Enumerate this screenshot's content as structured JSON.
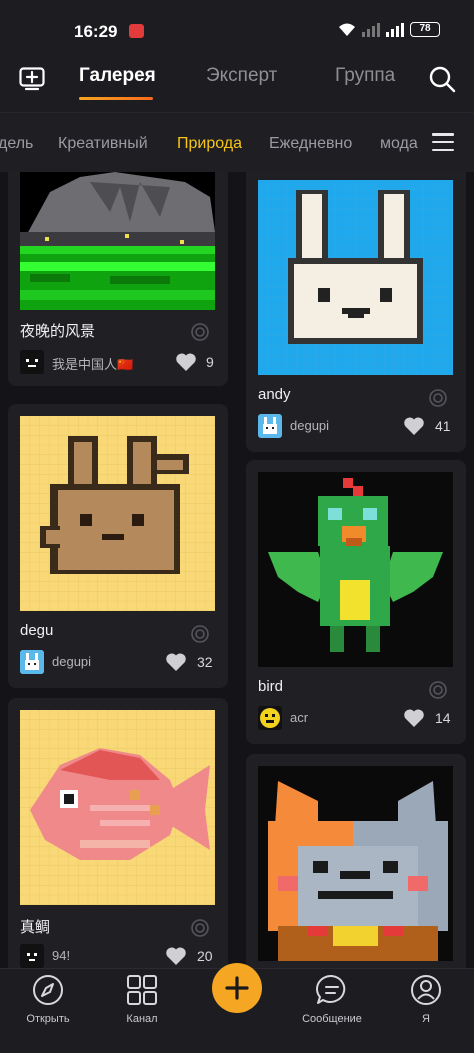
{
  "status_bar": {
    "time": "16:29",
    "battery": "78"
  },
  "header": {
    "tabs": [
      {
        "label": "Галерея",
        "active": true
      },
      {
        "label": "Эксперт",
        "active": false
      },
      {
        "label": "Группа",
        "active": false
      }
    ],
    "icons": {
      "left": "add-box-icon",
      "right": "search-icon"
    }
  },
  "categories": {
    "items": [
      "дель",
      "Креативный",
      "Природа",
      "Ежедневно",
      "мода"
    ],
    "active": "Природа",
    "menu_icon": "hamburger-menu-icon"
  },
  "feed": {
    "left": [
      {
        "title": "夜晚的风景",
        "user": "我是中国人🇨🇳",
        "likes": "9",
        "avatar_icon": "dark-face-avatar-icon"
      },
      {
        "title": "degu",
        "user": "degupi",
        "likes": "32",
        "avatar_icon": "bunny-avatar-icon"
      },
      {
        "title": "真鲷",
        "user": "94!",
        "likes": "20",
        "avatar_icon": "dark-face-avatar-icon"
      }
    ],
    "right": [
      {
        "title": "andy",
        "user": "degupi",
        "likes": "41",
        "avatar_icon": "bunny-avatar-icon"
      },
      {
        "title": "bird",
        "user": "acr",
        "likes": "14",
        "avatar_icon": "yellow-face-avatar-icon"
      }
    ]
  },
  "bottom_nav": [
    {
      "label": "Открыть",
      "icon": "compass-icon"
    },
    {
      "label": "Канал",
      "icon": "grid-icon"
    },
    {
      "label": "",
      "icon": "plus-icon"
    },
    {
      "label": "Сообщение",
      "icon": "chat-icon"
    },
    {
      "label": "Я",
      "icon": "profile-icon"
    }
  ],
  "colors": {
    "accent": "#f5c518",
    "fab": "#f5a623",
    "background": "#141418",
    "card": "#1f1f24"
  }
}
